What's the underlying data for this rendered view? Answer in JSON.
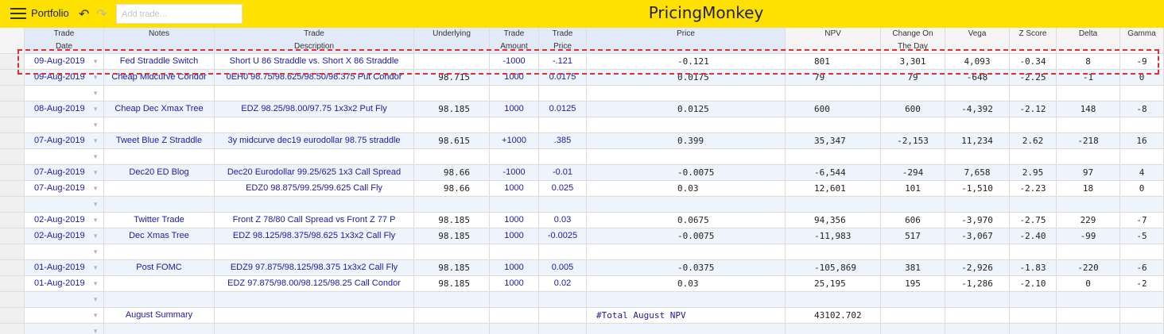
{
  "topbar": {
    "menu_icon": "hamburger-menu-icon",
    "portfolio_label": "Portfolio",
    "undo_icon": "undo-icon",
    "redo_icon": "redo-icon",
    "add_trade_placeholder": "Add trade...",
    "brand": "PricingMonkey",
    "background_color": "#ffe100"
  },
  "columns": [
    {
      "line1": "Trade",
      "line2": "Date"
    },
    {
      "line1": "Notes",
      "line2": ""
    },
    {
      "line1": "Trade",
      "line2": "Description"
    },
    {
      "line1": "Underlying",
      "line2": ""
    },
    {
      "line1": "Trade",
      "line2": "Amount"
    },
    {
      "line1": "Trade",
      "line2": "Price"
    },
    {
      "line1": "Price",
      "line2": ""
    },
    {
      "line1": "NPV",
      "line2": ""
    },
    {
      "line1": "Change On",
      "line2": "The Day"
    },
    {
      "line1": "Vega",
      "line2": ""
    },
    {
      "line1": "Z Score",
      "line2": ""
    },
    {
      "line1": "Delta",
      "line2": ""
    },
    {
      "line1": "Gamma",
      "line2": ""
    }
  ],
  "rows": [
    {
      "date": "09-Aug-2019",
      "notes": "Fed Straddle Switch",
      "desc": "Short U 86 Straddle vs. Short X 86 Straddle",
      "underlying": "",
      "amount": "-1000",
      "tprice": "-.121",
      "price": "-0.121",
      "npv": "801",
      "change": "3,301",
      "vega": "4,093",
      "z": "-0.34",
      "delta": "8",
      "gamma": "-9"
    },
    {
      "date": "09-Aug-2019",
      "notes": "Cheap Midcurve Condor",
      "desc": "0EH0 98.75/98.625/98.50/98.375 Put Condor",
      "underlying": "98.715",
      "amount": "1000",
      "tprice": "0.0175",
      "price": "0.0175",
      "npv": "79",
      "change": "79",
      "vega": "-648",
      "z": "-2.25",
      "delta": "-1",
      "gamma": "0"
    },
    {
      "date": "",
      "notes": "",
      "desc": "",
      "underlying": "",
      "amount": "",
      "tprice": "",
      "price": "",
      "npv": "",
      "change": "",
      "vega": "",
      "z": "",
      "delta": "",
      "gamma": ""
    },
    {
      "date": "08-Aug-2019",
      "notes": "Cheap Dec Xmax Tree",
      "desc": "EDZ 98.25/98.00/97.75 1x3x2 Put Fly",
      "underlying": "98.185",
      "amount": "1000",
      "tprice": "0.0125",
      "price": "0.0125",
      "npv": "600",
      "change": "600",
      "vega": "-4,392",
      "z": "-2.12",
      "delta": "148",
      "gamma": "-8"
    },
    {
      "date": "",
      "notes": "",
      "desc": "",
      "underlying": "",
      "amount": "",
      "tprice": "",
      "price": "",
      "npv": "",
      "change": "",
      "vega": "",
      "z": "",
      "delta": "",
      "gamma": ""
    },
    {
      "date": "07-Aug-2019",
      "notes": "Tweet Blue Z Straddle",
      "desc": "3y midcurve dec19 eurodollar 98.75 straddle",
      "underlying": "98.615",
      "amount": "+1000",
      "tprice": ".385",
      "price": "0.399",
      "npv": "35,347",
      "change": "-2,153",
      "vega": "11,234",
      "z": "2.62",
      "delta": "-218",
      "gamma": "16"
    },
    {
      "date": "",
      "notes": "",
      "desc": "",
      "underlying": "",
      "amount": "",
      "tprice": "",
      "price": "",
      "npv": "",
      "change": "",
      "vega": "",
      "z": "",
      "delta": "",
      "gamma": ""
    },
    {
      "date": "07-Aug-2019",
      "notes": "Dec20 ED Blog",
      "desc": "Dec20 Eurodollar 99.25/625 1x3 Call Spread",
      "underlying": "98.66",
      "amount": "-1000",
      "tprice": "-0.01",
      "price": "-0.0075",
      "npv": "-6,544",
      "change": "-294",
      "vega": "7,658",
      "z": "2.95",
      "delta": "97",
      "gamma": "4"
    },
    {
      "date": "07-Aug-2019",
      "notes": "",
      "desc": "EDZ0 98.875/99.25/99.625 Call Fly",
      "underlying": "98.66",
      "amount": "1000",
      "tprice": "0.025",
      "price": "0.03",
      "npv": "12,601",
      "change": "101",
      "vega": "-1,510",
      "z": "-2.23",
      "delta": "18",
      "gamma": "0"
    },
    {
      "date": "",
      "notes": "",
      "desc": "",
      "underlying": "",
      "amount": "",
      "tprice": "",
      "price": "",
      "npv": "",
      "change": "",
      "vega": "",
      "z": "",
      "delta": "",
      "gamma": ""
    },
    {
      "date": "02-Aug-2019",
      "notes": "Twitter Trade",
      "desc": "Front Z 78/80 Call Spread vs Front Z 77 P",
      "underlying": "98.185",
      "amount": "1000",
      "tprice": "0.03",
      "price": "0.0675",
      "npv": "94,356",
      "change": "606",
      "vega": "-3,970",
      "z": "-2.75",
      "delta": "229",
      "gamma": "-7"
    },
    {
      "date": "02-Aug-2019",
      "notes": "Dec Xmas Tree",
      "desc": "EDZ 98.125/98.375/98.625 1x3x2 Call Fly",
      "underlying": "98.185",
      "amount": "1000",
      "tprice": "-0.0025",
      "price": "-0.0075",
      "npv": "-11,983",
      "change": "517",
      "vega": "-3,067",
      "z": "-2.40",
      "delta": "-99",
      "gamma": "-5"
    },
    {
      "date": "",
      "notes": "",
      "desc": "",
      "underlying": "",
      "amount": "",
      "tprice": "",
      "price": "",
      "npv": "",
      "change": "",
      "vega": "",
      "z": "",
      "delta": "",
      "gamma": ""
    },
    {
      "date": "01-Aug-2019",
      "notes": "Post FOMC",
      "desc": "EDZ9 97.875/98.125/98.375 1x3x2 Call Fly",
      "underlying": "98.185",
      "amount": "1000",
      "tprice": "0.005",
      "price": "-0.0375",
      "npv": "-105,869",
      "change": "381",
      "vega": "-2,926",
      "z": "-1.83",
      "delta": "-220",
      "gamma": "-6"
    },
    {
      "date": "01-Aug-2019",
      "notes": "",
      "desc": "EDZ 97.875/98.00/98.125/98.25 Call Condor",
      "underlying": "98.185",
      "amount": "1000",
      "tprice": "0.02",
      "price": "0.03",
      "npv": "25,195",
      "change": "195",
      "vega": "-1,286",
      "z": "-2.10",
      "delta": "0",
      "gamma": "-2"
    },
    {
      "date": "",
      "notes": "",
      "desc": "",
      "underlying": "",
      "amount": "",
      "tprice": "",
      "price": "",
      "npv": "",
      "change": "",
      "vega": "",
      "z": "",
      "delta": "",
      "gamma": ""
    },
    {
      "date": "",
      "notes": "August Summary",
      "desc": "",
      "underlying": "",
      "amount": "",
      "tprice": "",
      "price": "#Total August NPV",
      "npv": "43102.702",
      "change": "",
      "vega": "",
      "z": "",
      "delta": "",
      "gamma": "",
      "summary": true
    },
    {
      "date": "",
      "notes": "",
      "desc": "",
      "underlying": "",
      "amount": "",
      "tprice": "",
      "price": "",
      "npv": "",
      "change": "",
      "vega": "",
      "z": "",
      "delta": "",
      "gamma": ""
    }
  ],
  "colors": {
    "cell_text": "#1a1aa8",
    "alt_row": "#eef4fc",
    "selection_border": "#e03030"
  }
}
